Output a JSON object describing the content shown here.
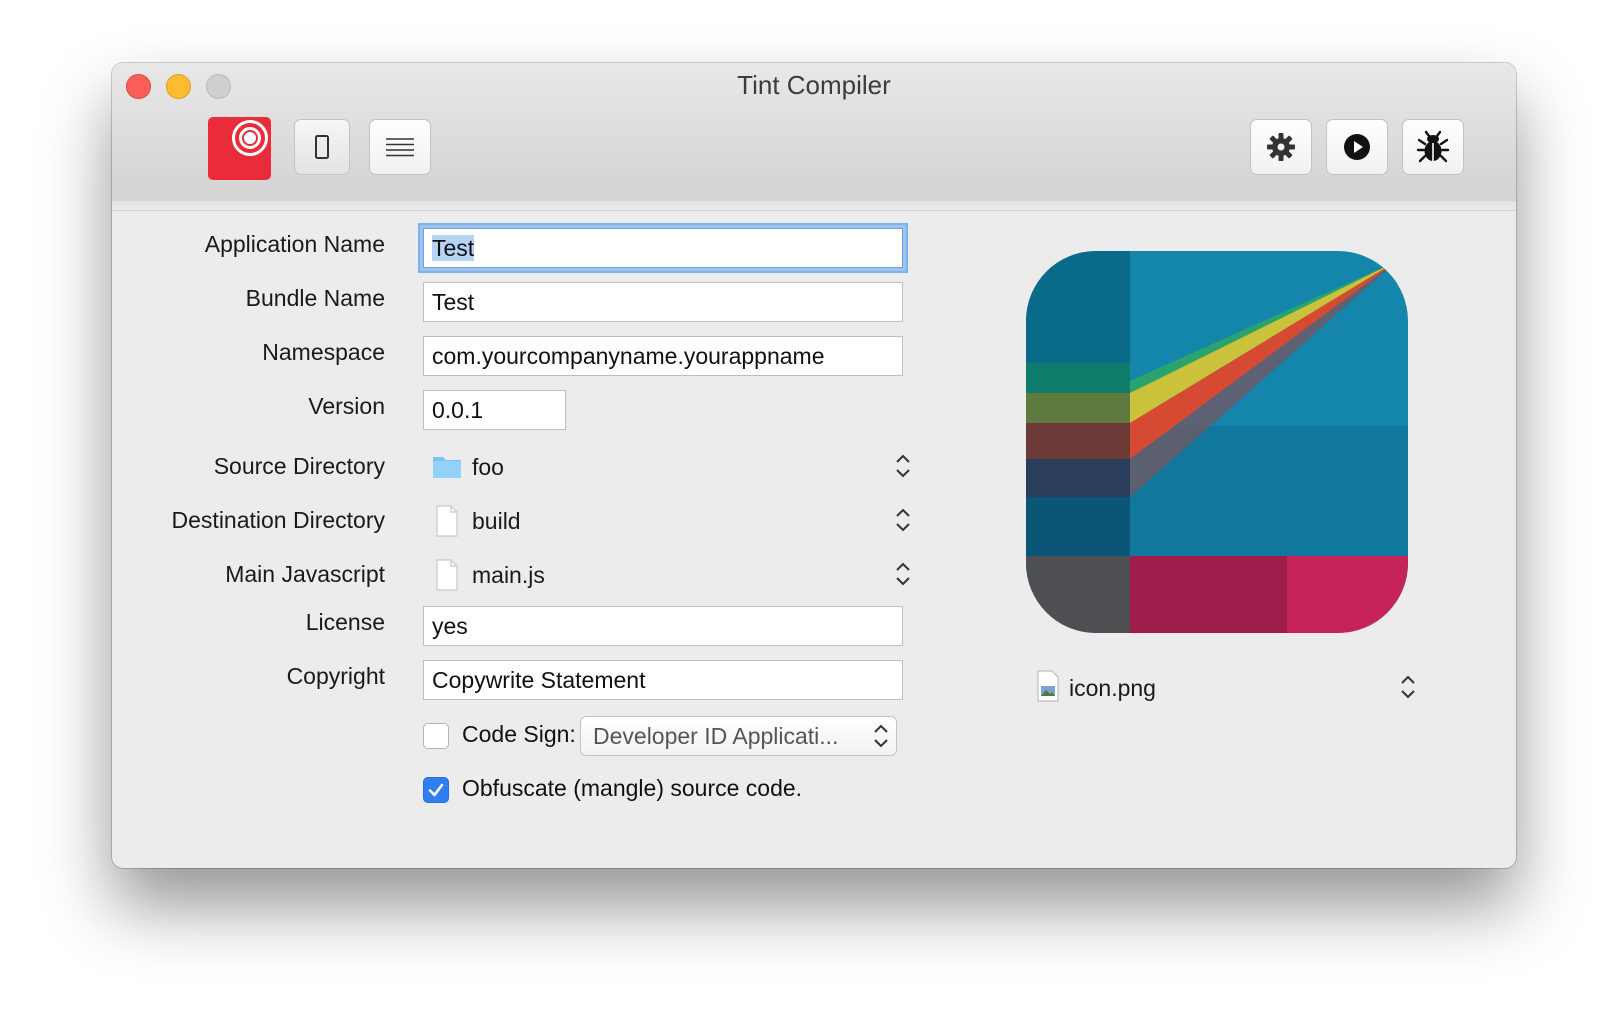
{
  "window": {
    "title": "Tint Compiler"
  },
  "form": {
    "application_name": {
      "label": "Application Name",
      "value": "Test"
    },
    "bundle_name": {
      "label": "Bundle Name",
      "value": "Test"
    },
    "namespace": {
      "label": "Namespace",
      "value": "com.yourcompanyname.yourappname"
    },
    "version": {
      "label": "Version",
      "value": "0.0.1"
    },
    "source_directory": {
      "label": "Source Directory",
      "value": "foo"
    },
    "destination_directory": {
      "label": "Destination Directory",
      "value": "build"
    },
    "main_javascript": {
      "label": "Main Javascript",
      "value": "main.js"
    },
    "license": {
      "label": "License",
      "value": "yes"
    },
    "copyright": {
      "label": "Copyright",
      "value": "Copywrite Statement"
    },
    "code_sign": {
      "label": "Code Sign:",
      "checked": false,
      "selected": "Developer ID Applicati..."
    },
    "obfuscate": {
      "label": "Obfuscate (mangle) source code.",
      "checked": true
    }
  },
  "icon": {
    "file": "icon.png"
  },
  "icons": {
    "toolbar": [
      "tint-logo-icon",
      "phone-icon",
      "list-icon",
      "gear-icon",
      "play-icon",
      "bug-icon"
    ],
    "popups": [
      "folder-icon",
      "document-icon",
      "document-icon",
      "image-file-icon",
      "up-down-arrows-icon"
    ]
  },
  "colors": {
    "accent": "#2f7ff0",
    "focus_ring": "#7fb0ea",
    "brand_red": "#ea2b3a"
  }
}
